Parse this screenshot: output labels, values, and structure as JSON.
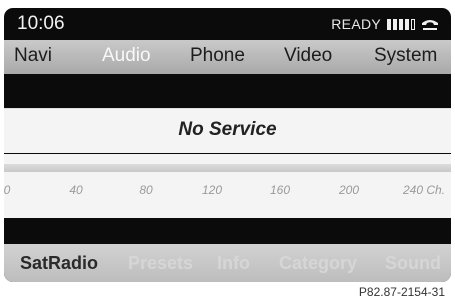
{
  "status": {
    "time": "10:06",
    "ready_text": "READY",
    "signal_bars_filled": 4,
    "signal_bars_total": 5,
    "phone_icon": "phone-handset-icon"
  },
  "main_menu": {
    "items": [
      {
        "label": "Navi",
        "active": false
      },
      {
        "label": "Audio",
        "active": true
      },
      {
        "label": "Phone",
        "active": false
      },
      {
        "label": "Video",
        "active": false
      },
      {
        "label": "System",
        "active": false
      }
    ]
  },
  "main": {
    "message": "No Service"
  },
  "scale": {
    "ticks": [
      "0",
      "40",
      "80",
      "120",
      "160",
      "200",
      "240 Ch."
    ]
  },
  "bottom_menu": {
    "items": [
      {
        "label": "SatRadio",
        "active": true
      },
      {
        "label": "Presets",
        "active": false
      },
      {
        "label": "Info",
        "active": false
      },
      {
        "label": "Category",
        "active": false
      },
      {
        "label": "Sound",
        "active": false
      }
    ]
  },
  "figure_id": "P82.87-2154-31",
  "colors": {
    "screen_bg": "#0b0b0b",
    "menu_bg": "#b8b8b8",
    "active_text": "#f8f8f8",
    "inactive_bottom_text": "#d6d6d6"
  }
}
